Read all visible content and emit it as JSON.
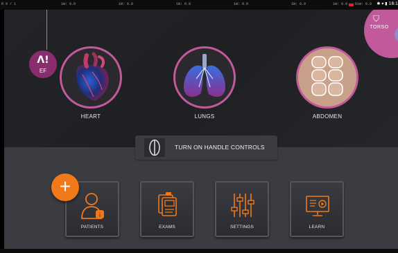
{
  "status_bar": {
    "ruler_labels": [
      "R 0 / 1",
      "1W: 0.0",
      "1W: 0.0",
      "1W: 0.0",
      "1W: 0.0",
      "1W: 0.0",
      "1W: 0.0",
      "Dim: 0.0"
    ],
    "time": "18:1",
    "icons": [
      "bluetooth-icon",
      "wifi-icon",
      "battery-icon"
    ],
    "marker_color": "#dd2233"
  },
  "ef_badge": {
    "label": "EF"
  },
  "torso_tab": {
    "label": "TORSO"
  },
  "organs": [
    {
      "id": "heart",
      "label": "HEART"
    },
    {
      "id": "lungs",
      "label": "LUNGS"
    },
    {
      "id": "abdomen",
      "label": "ABDOMEN"
    }
  ],
  "handle_controls": {
    "label": "TURN ON HANDLE CONTROLS"
  },
  "fab": {
    "symbol": "+",
    "color": "#f07a1a"
  },
  "tiles": [
    {
      "id": "patients",
      "label": "PATIENTS"
    },
    {
      "id": "exams",
      "label": "EXAMS"
    },
    {
      "id": "settings",
      "label": "SETTINGS"
    },
    {
      "id": "learn",
      "label": "LEARN"
    }
  ],
  "colors": {
    "accent_magenta": "#c2599a",
    "icon_orange": "#f07a1a",
    "background_dark": "#1f2024",
    "panel_gray": "#3b3c41"
  }
}
